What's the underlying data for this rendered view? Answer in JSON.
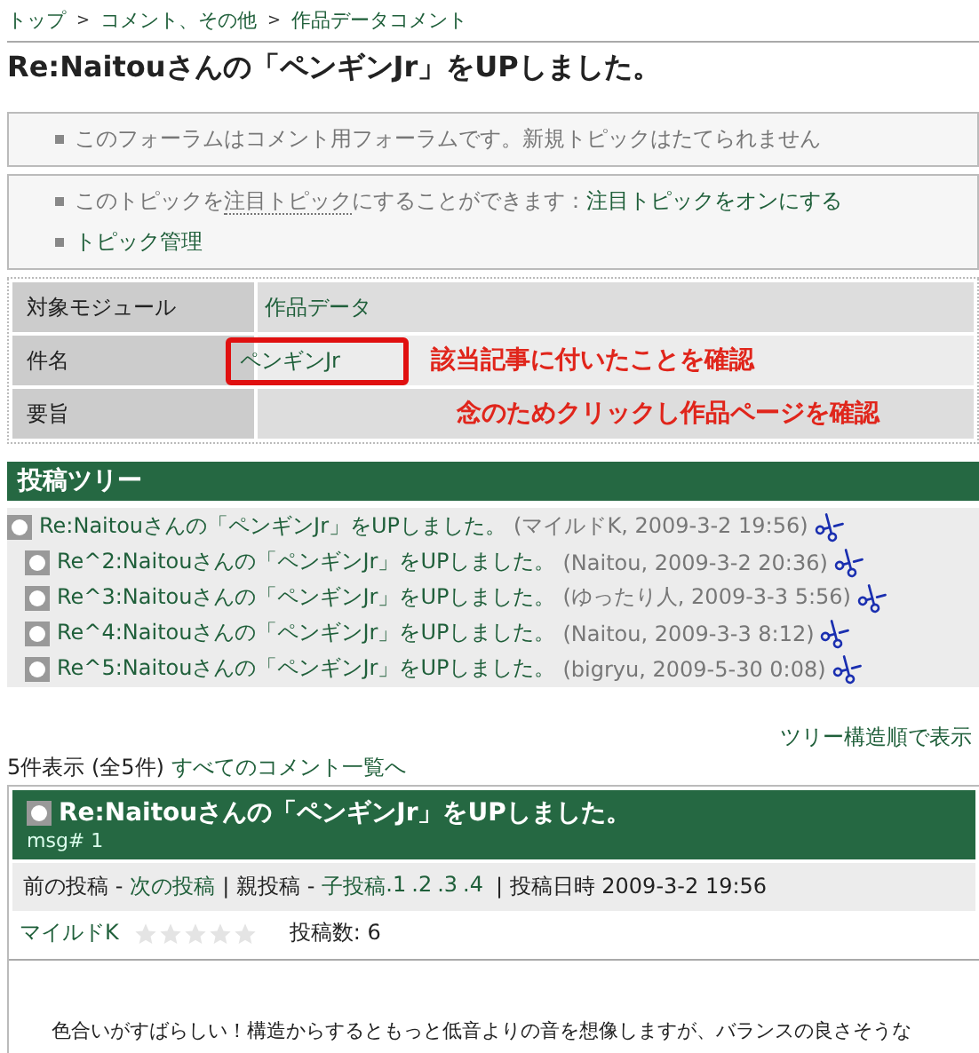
{
  "breadcrumb": {
    "separator": ">",
    "items": [
      "トップ",
      "コメント、その他",
      "作品データコメント"
    ]
  },
  "title": "Re:Naitouさんの「ペンギンJr」をUPしました。",
  "notice": "このフォーラムはコメント用フォーラムです。新規トピックはたてられません",
  "topic_box": {
    "watch_text": "このトピックを",
    "watch_term": "注目トピック",
    "watch_rest": "にすることができます：",
    "watch_link": "注目トピックをオンにする",
    "manage_link": "トピック管理"
  },
  "info_table": [
    {
      "label": "対象モジュール",
      "value": "作品データ",
      "highlighted": false
    },
    {
      "label": "件名",
      "value": "ペンギンJr",
      "highlighted": true,
      "note": "該当記事に付いたことを確認"
    },
    {
      "label": "要旨",
      "note": "念のためクリックし作品ページを確認",
      "highlighted": false
    }
  ],
  "tree": {
    "title": "投稿ツリー",
    "items": [
      {
        "title": "Re:Naitouさんの「ペンギンJr」をUPしました。",
        "meta": "(マイルドK, 2009-3-2 19:56)",
        "children": [
          {
            "title": "Re^2:Naitouさんの「ペンギンJr」をUPしました。",
            "meta": "(Naitou, 2009-3-2 20:36)"
          },
          {
            "title": "Re^3:Naitouさんの「ペンギンJr」をUPしました。",
            "meta": "(ゆったり人, 2009-3-3 5:56)"
          },
          {
            "title": "Re^4:Naitouさんの「ペンギンJr」をUPしました。",
            "meta": "(Naitou, 2009-3-3 8:12)"
          },
          {
            "title": "Re^5:Naitouさんの「ペンギンJr」をUPしました。",
            "meta": "(bigryu, 2009-5-30 0:08)"
          }
        ]
      }
    ]
  },
  "tree_order_link": "ツリー構造順で表示",
  "count": {
    "text": "5件表示 (全5件)",
    "link": "すべてのコメント一覧へ"
  },
  "post": {
    "title": "Re:Naitouさんの「ペンギンJr」をUPしました。",
    "msg": "msg# 1",
    "nav": {
      "prev": "前の投稿 -",
      "next": "次の投稿",
      "parent": "| 親投稿 -",
      "children_label": "子投稿",
      "children": [
        ".1",
        ".2",
        ".3",
        ".4"
      ],
      "date": "| 投稿日時 2009-3-2 19:56"
    },
    "author": "マイルドK",
    "stars": 0,
    "post_count": "投稿数: 6",
    "body": "色合いがすばらしい！構造からするともっと低音よりの音を想像しますが、バランスの良さそうな"
  }
}
